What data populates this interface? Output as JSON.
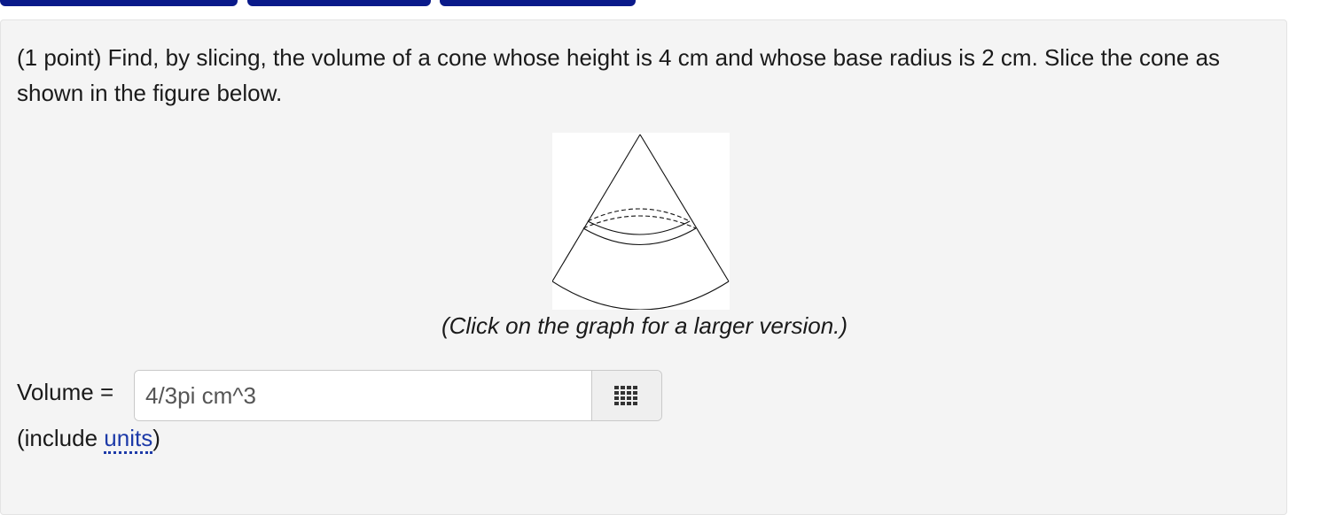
{
  "problem": {
    "statement": "(1 point) Find, by slicing, the volume of a cone whose height is 4 cm and whose base radius is 2 cm. Slice the cone as shown in the figure below.",
    "caption": "(Click on the graph for a larger version.)"
  },
  "answer": {
    "label": "Volume =",
    "value": "4/3pi cm^3"
  },
  "hint": {
    "prefix": "(include ",
    "link": "units",
    "suffix": ")"
  },
  "icons": {
    "keypad": "keypad-grid-icon",
    "figure": "cone-slice-figure"
  },
  "colors": {
    "nav_tab": "#0a1a8a",
    "link": "#1d3aa8",
    "panel_bg": "#f4f4f4"
  }
}
